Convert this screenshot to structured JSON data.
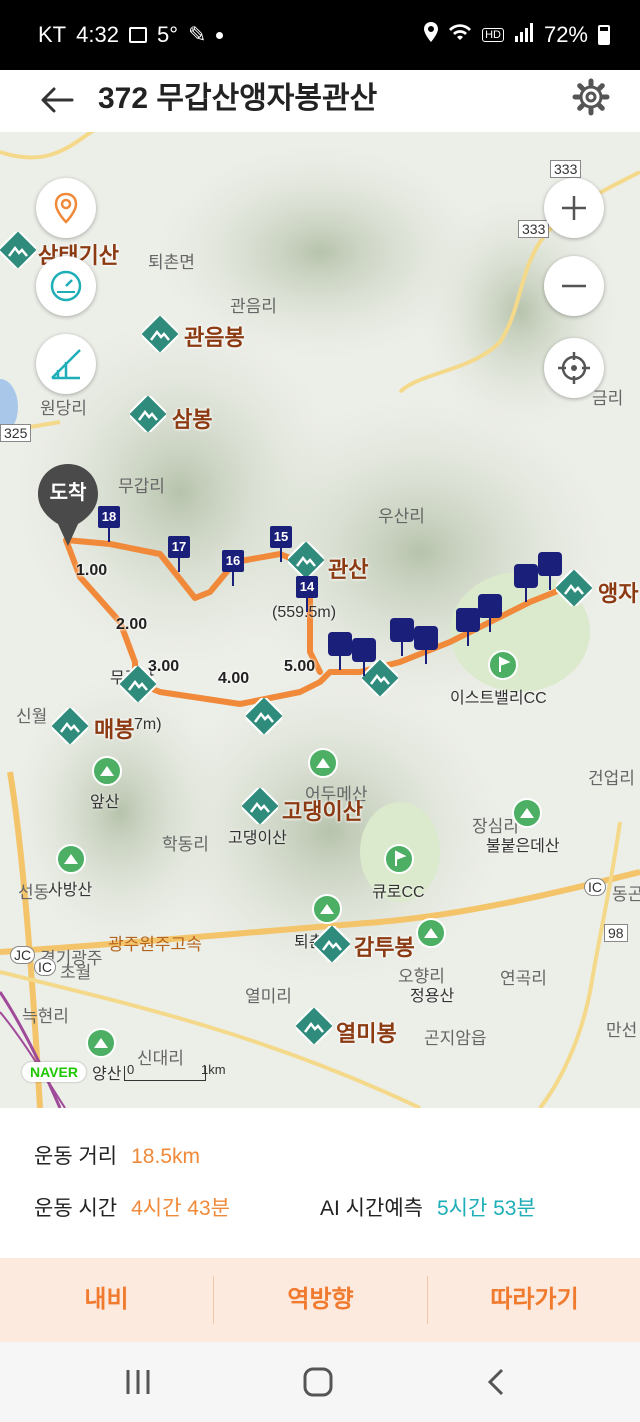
{
  "status_bar": {
    "carrier": "KT",
    "time": "4:32",
    "temperature": "5°",
    "battery": "72%"
  },
  "header": {
    "title": "372 무갑산앵자봉관산"
  },
  "map": {
    "arrival_label": "도착",
    "places": [
      "퇴촌면",
      "관음리",
      "원당리",
      "무갑리",
      "우산리",
      "신월",
      "학동리",
      "선동",
      "어두메산",
      "장심리",
      "건업리",
      "열미리",
      "신대리",
      "연곡리",
      "곤지암읍",
      "오향리",
      "초월",
      "늑현리",
      "경기광주",
      "동곤",
      "만선",
      "금리"
    ],
    "peaks": [
      "삼태기산",
      "관음봉",
      "삼봉",
      "관산",
      "앵자",
      "매봉",
      "고댕이산",
      "감투봉",
      "열미봉"
    ],
    "small_labels": [
      "무갑산",
      "(559.5m)",
      "7m)",
      "고댕이산",
      "앞산",
      "사방산",
      "불붙은데산",
      "정용산",
      "큐로CC",
      "이스트밸리CC",
      "퇴촌",
      "양산"
    ],
    "km_markers": [
      "1.00",
      "2.00",
      "3.00",
      "4.00",
      "5.00"
    ],
    "flags": [
      "18",
      "17",
      "16",
      "15",
      "14"
    ],
    "roads": [
      "333",
      "333",
      "325",
      "98",
      "IC",
      "JC",
      "IC"
    ],
    "road_names": [
      "광주원주고속"
    ],
    "naver_logo": "NAVER",
    "scale_0": "0",
    "scale_1": "1km"
  },
  "stats": {
    "distance_label": "운동 거리",
    "distance_value": "18.5km",
    "time_label": "운동 시간",
    "time_value": "4시간 43분",
    "ai_label": "AI 시간예측",
    "ai_value": "5시간 53분"
  },
  "actions": {
    "navi": "내비",
    "reverse": "역방향",
    "follow": "따라가기"
  },
  "colors": {
    "accent": "#f08a3a",
    "ai": "#1eaeb8",
    "flag": "#1a1f7a",
    "route": "#f08a3a",
    "peak": "#8b3a12"
  }
}
